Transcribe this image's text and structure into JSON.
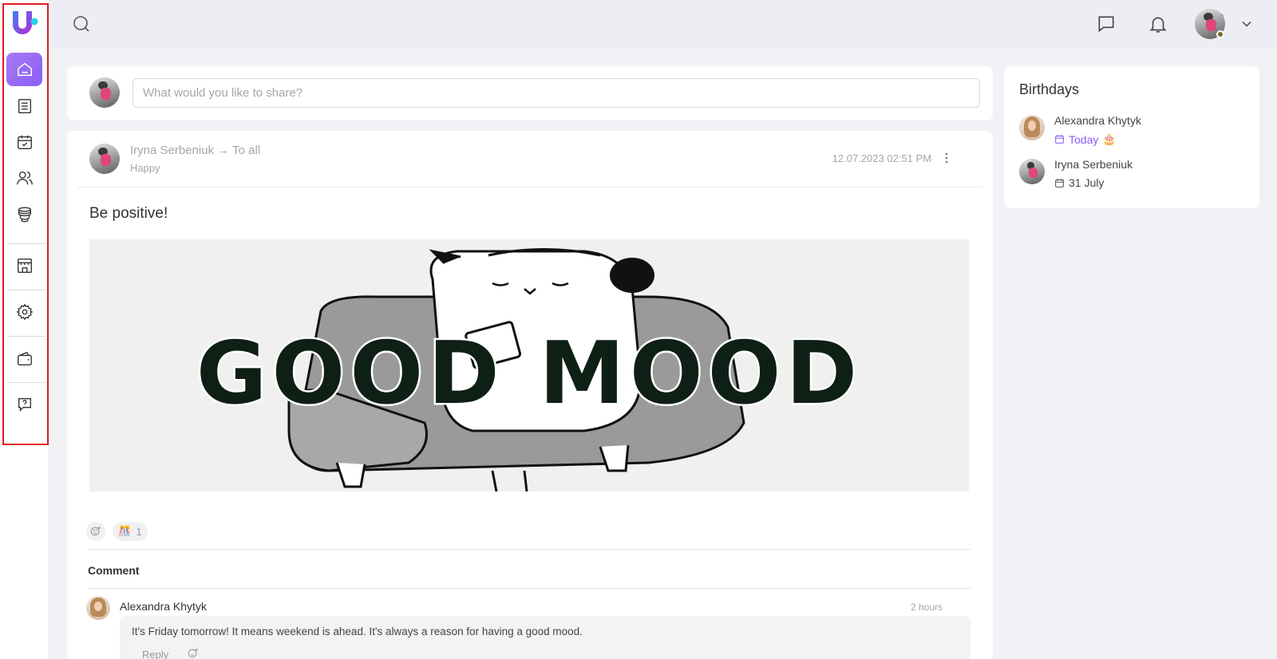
{
  "topbar": {
    "icons": [
      "search-icon",
      "chat-icon",
      "bell-icon",
      "chevron-down-icon"
    ]
  },
  "sidebar": {
    "items": [
      {
        "name": "home",
        "icon": "home-icon",
        "active": true
      },
      {
        "name": "documents",
        "icon": "document-list-icon"
      },
      {
        "name": "calendar",
        "icon": "calendar-check-icon"
      },
      {
        "name": "people",
        "icon": "users-icon"
      },
      {
        "name": "coins",
        "icon": "coins-icon"
      },
      {
        "name": "store",
        "icon": "store-icon"
      },
      {
        "name": "settings",
        "icon": "gear-icon"
      },
      {
        "name": "wallet",
        "icon": "wallet-icon"
      },
      {
        "name": "help",
        "icon": "help-chat-icon"
      }
    ],
    "accent": "#8b5cf6"
  },
  "share": {
    "placeholder": "What would you like to share?"
  },
  "post": {
    "author": "Iryna Serbeniuk",
    "arrow": "→",
    "audience": "To all",
    "mood": "Happy",
    "date": "12.07.2023 02:51 PM",
    "title": "Be positive!",
    "image_text": "GOOD MOOD",
    "reaction_emoji": "🎊",
    "reaction_count": "1",
    "comment_heading": "Comment",
    "comment": {
      "author": "Alexandra Khytyk",
      "time": "2 hours",
      "text": "It's Friday tomorrow! It means weekend is ahead. It's always a reason for having a good mood.",
      "reply_label": "Reply"
    }
  },
  "birthdays": {
    "title": "Birthdays",
    "items": [
      {
        "name": "Alexandra Khytyk",
        "date": "Today",
        "emoji": "🎂",
        "highlight": true
      },
      {
        "name": "Iryna Serbeniuk",
        "date": "31 July",
        "highlight": false
      }
    ]
  }
}
